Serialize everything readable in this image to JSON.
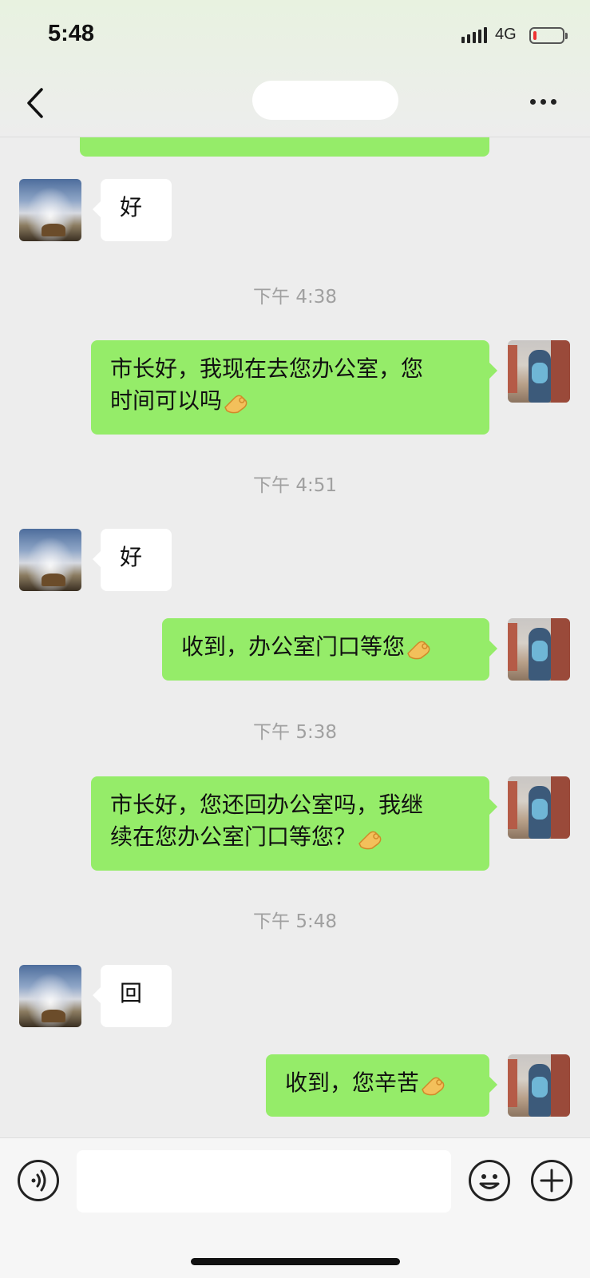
{
  "status_bar": {
    "time": "5:48",
    "network": "4G",
    "battery_level": 0.1
  },
  "nav": {
    "back_icon": "chevron-left-icon",
    "more_icon": "more-dots-icon"
  },
  "messages": [
    {
      "type": "incoming",
      "text": "好"
    },
    {
      "type": "timestamp",
      "text": "下午 4:38"
    },
    {
      "type": "outgoing",
      "line1": "市长好，我现在去您办公室，您",
      "line2": "时间可以吗",
      "emoji": "ok-hand-emoji"
    },
    {
      "type": "timestamp",
      "text": "下午 4:51"
    },
    {
      "type": "incoming",
      "text": "好"
    },
    {
      "type": "outgoing",
      "text": "收到，办公室门口等您",
      "emoji": "ok-hand-emoji"
    },
    {
      "type": "timestamp",
      "text": "下午 5:38"
    },
    {
      "type": "outgoing",
      "line1": "市长好，您还回办公室吗，我继",
      "line2": "续在您办公室门口等您？",
      "emoji": "ok-hand-emoji"
    },
    {
      "type": "timestamp",
      "text": "下午 5:48"
    },
    {
      "type": "incoming",
      "text": "回"
    },
    {
      "type": "outgoing",
      "text": "收到，您辛苦",
      "emoji": "ok-hand-emoji"
    }
  ],
  "input_bar": {
    "voice_icon": "voice-icon",
    "emoji_icon": "smiley-icon",
    "plus_icon": "plus-icon",
    "text_value": ""
  }
}
